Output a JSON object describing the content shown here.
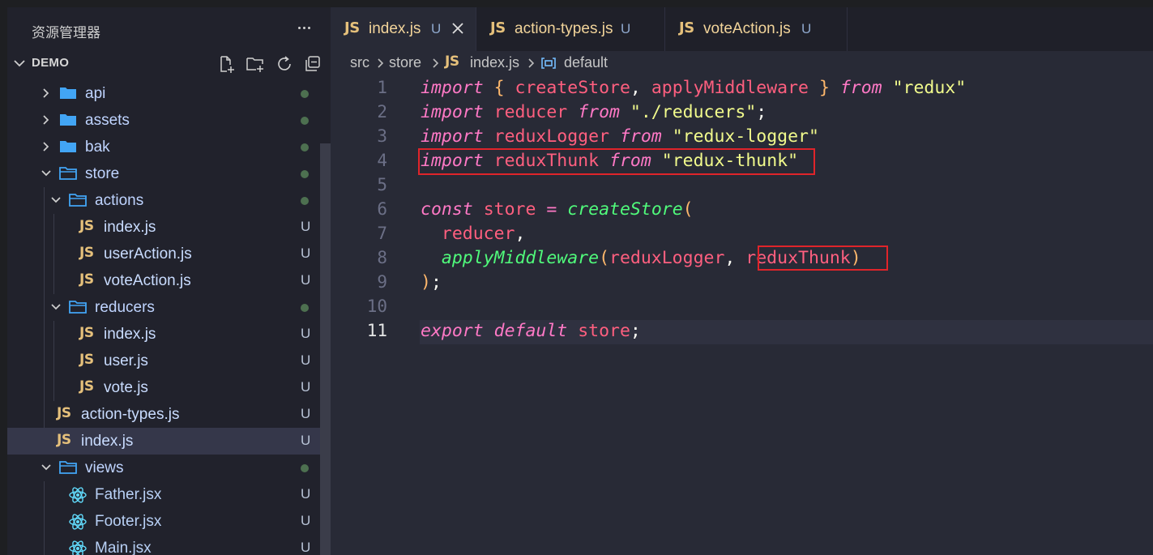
{
  "sidebar": {
    "title": "资源管理器",
    "project": "DEMO",
    "tree": [
      {
        "label": "api",
        "type": "folder",
        "depth": 1,
        "expanded": false,
        "status": "dot"
      },
      {
        "label": "assets",
        "type": "folder",
        "depth": 1,
        "expanded": false,
        "status": "dot"
      },
      {
        "label": "bak",
        "type": "folder",
        "depth": 1,
        "expanded": false,
        "status": "dot"
      },
      {
        "label": "store",
        "type": "folder",
        "depth": 1,
        "expanded": true,
        "status": "dot"
      },
      {
        "label": "actions",
        "type": "folder",
        "depth": 2,
        "expanded": true,
        "status": "dot"
      },
      {
        "label": "index.js",
        "type": "js",
        "depth": 3,
        "status": "U"
      },
      {
        "label": "userAction.js",
        "type": "js",
        "depth": 3,
        "status": "U"
      },
      {
        "label": "voteAction.js",
        "type": "js",
        "depth": 3,
        "status": "U"
      },
      {
        "label": "reducers",
        "type": "folder",
        "depth": 2,
        "expanded": true,
        "status": "dot"
      },
      {
        "label": "index.js",
        "type": "js",
        "depth": 3,
        "status": "U"
      },
      {
        "label": "user.js",
        "type": "js",
        "depth": 3,
        "status": "U"
      },
      {
        "label": "vote.js",
        "type": "js",
        "depth": 3,
        "status": "U"
      },
      {
        "label": "action-types.js",
        "type": "js",
        "depth": 2,
        "status": "U"
      },
      {
        "label": "index.js",
        "type": "js",
        "depth": 2,
        "status": "U",
        "selected": true
      },
      {
        "label": "views",
        "type": "folder",
        "depth": 1,
        "expanded": true,
        "status": "dot"
      },
      {
        "label": "Father.jsx",
        "type": "jsx",
        "depth": 2,
        "status": "U"
      },
      {
        "label": "Footer.jsx",
        "type": "jsx",
        "depth": 2,
        "status": "U"
      },
      {
        "label": "Main.jsx",
        "type": "jsx",
        "depth": 2,
        "status": "U"
      }
    ]
  },
  "tabs": [
    {
      "badge": "JS",
      "label": "index.js",
      "status": "U",
      "active": true
    },
    {
      "badge": "JS",
      "label": "action-types.js",
      "status": "U",
      "active": false
    },
    {
      "badge": "JS",
      "label": "voteAction.js",
      "status": "U",
      "active": false
    }
  ],
  "breadcrumb": {
    "parts": [
      "src",
      "store",
      "index.js",
      "default"
    ],
    "file_badge": "JS"
  },
  "editor": {
    "current_line": 11,
    "line_numbers": [
      "1",
      "2",
      "3",
      "4",
      "5",
      "6",
      "7",
      "8",
      "9",
      "10",
      "11"
    ],
    "lines": [
      [
        {
          "t": "import",
          "c": "kw"
        },
        {
          "t": " ",
          "c": "punc"
        },
        {
          "t": "{",
          "c": "brace"
        },
        {
          "t": " ",
          "c": "punc"
        },
        {
          "t": "createStore",
          "c": "var"
        },
        {
          "t": ", ",
          "c": "punc"
        },
        {
          "t": "applyMiddleware",
          "c": "var"
        },
        {
          "t": " ",
          "c": "punc"
        },
        {
          "t": "}",
          "c": "brace"
        },
        {
          "t": " ",
          "c": "punc"
        },
        {
          "t": "from",
          "c": "kw"
        },
        {
          "t": " ",
          "c": "punc"
        },
        {
          "t": "\"redux\"",
          "c": "str"
        }
      ],
      [
        {
          "t": "import",
          "c": "kw"
        },
        {
          "t": " ",
          "c": "punc"
        },
        {
          "t": "reducer",
          "c": "var"
        },
        {
          "t": " ",
          "c": "punc"
        },
        {
          "t": "from",
          "c": "kw"
        },
        {
          "t": " ",
          "c": "punc"
        },
        {
          "t": "\"./reducers\"",
          "c": "str"
        },
        {
          "t": ";",
          "c": "punc"
        }
      ],
      [
        {
          "t": "import",
          "c": "kw"
        },
        {
          "t": " ",
          "c": "punc"
        },
        {
          "t": "reduxLogger",
          "c": "var"
        },
        {
          "t": " ",
          "c": "punc"
        },
        {
          "t": "from",
          "c": "kw"
        },
        {
          "t": " ",
          "c": "punc"
        },
        {
          "t": "\"redux-logger\"",
          "c": "str"
        }
      ],
      [
        {
          "t": "import",
          "c": "kw"
        },
        {
          "t": " ",
          "c": "punc"
        },
        {
          "t": "reduxThunk",
          "c": "var"
        },
        {
          "t": " ",
          "c": "punc"
        },
        {
          "t": "from",
          "c": "kw"
        },
        {
          "t": " ",
          "c": "punc"
        },
        {
          "t": "\"redux-thunk\"",
          "c": "str"
        }
      ],
      [],
      [
        {
          "t": "const",
          "c": "kw"
        },
        {
          "t": " ",
          "c": "punc"
        },
        {
          "t": "store",
          "c": "var"
        },
        {
          "t": " ",
          "c": "punc"
        },
        {
          "t": "=",
          "c": "op"
        },
        {
          "t": " ",
          "c": "punc"
        },
        {
          "t": "createStore",
          "c": "fn"
        },
        {
          "t": "(",
          "c": "brace"
        }
      ],
      [
        {
          "t": "  ",
          "c": "punc"
        },
        {
          "t": "reducer",
          "c": "var"
        },
        {
          "t": ",",
          "c": "punc"
        }
      ],
      [
        {
          "t": "  ",
          "c": "punc"
        },
        {
          "t": "applyMiddleware",
          "c": "fn"
        },
        {
          "t": "(",
          "c": "brace"
        },
        {
          "t": "reduxLogger",
          "c": "var"
        },
        {
          "t": ", ",
          "c": "punc"
        },
        {
          "t": "reduxThunk",
          "c": "var"
        },
        {
          "t": ")",
          "c": "brace"
        }
      ],
      [
        {
          "t": ")",
          "c": "brace"
        },
        {
          "t": ";",
          "c": "punc"
        }
      ],
      [],
      [
        {
          "t": "export",
          "c": "kw"
        },
        {
          "t": " ",
          "c": "punc"
        },
        {
          "t": "default",
          "c": "kw"
        },
        {
          "t": " ",
          "c": "punc"
        },
        {
          "t": "store",
          "c": "var"
        },
        {
          "t": ";",
          "c": "punc"
        }
      ]
    ]
  },
  "colors": {
    "highlight_box": "#e0242a",
    "js_badge": "#e5c07b",
    "keyword": "#ff79c6",
    "string": "#f1fa8c",
    "function": "#50fa7b"
  }
}
